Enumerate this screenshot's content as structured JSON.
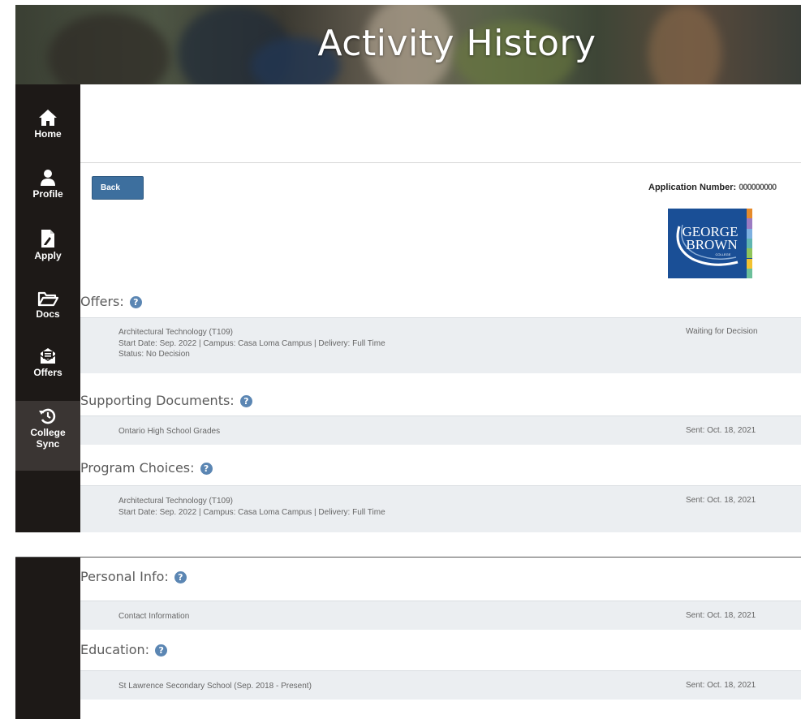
{
  "header": {
    "title": "Activity History"
  },
  "nav": {
    "items": [
      {
        "label": "Home",
        "icon": "home-icon"
      },
      {
        "label": "Profile",
        "icon": "user-icon"
      },
      {
        "label": "Apply",
        "icon": "document-pen-icon"
      },
      {
        "label": "Docs",
        "icon": "folder-icon"
      },
      {
        "label": "Offers",
        "icon": "envelope-icon"
      },
      {
        "label": "College",
        "label2": "Sync",
        "icon": "history-icon",
        "active": true
      }
    ]
  },
  "toolbar": {
    "back_label": "Back",
    "application_number_label": "Application Number:",
    "application_number_value": "000000000"
  },
  "logo": {
    "line1": "GEORGE",
    "line2": "BROWN",
    "line3": "COLLEGE"
  },
  "sections": {
    "offers": {
      "title": "Offers:",
      "items": [
        {
          "line1": "Architectural Technology (T109)",
          "line2": "Start Date: Sep. 2022 | Campus: Casa Loma Campus | Delivery: Full Time",
          "line3": "Status: No Decision",
          "status": "Waiting for Decision"
        }
      ]
    },
    "supporting_documents": {
      "title": "Supporting Documents:",
      "items": [
        {
          "line1": "Ontario High School Grades",
          "status": "Sent: Oct. 18, 2021"
        }
      ]
    },
    "program_choices": {
      "title": "Program Choices:",
      "items": [
        {
          "line1": "Architectural Technology (T109)",
          "line2": "Start Date: Sep. 2022 | Campus: Casa Loma Campus | Delivery: Full Time",
          "status": "Sent: Oct. 18, 2021"
        }
      ]
    },
    "personal_info": {
      "title": "Personal Info:",
      "items": [
        {
          "line1": "Contact Information",
          "status": "Sent: Oct. 18, 2021"
        }
      ]
    },
    "education": {
      "title": "Education:",
      "items": [
        {
          "line1": "St Lawrence Secondary School (Sep. 2018 - Present)",
          "status": "Sent: Oct. 18, 2021"
        }
      ]
    }
  },
  "colors": {
    "sidebar": "#1d1917",
    "sidebar_active": "#3a3533",
    "button": "#3d6f9e",
    "row_bg": "#ebeef1",
    "help_icon": "#5b86b3",
    "logo_bg": "#1a4f96"
  }
}
